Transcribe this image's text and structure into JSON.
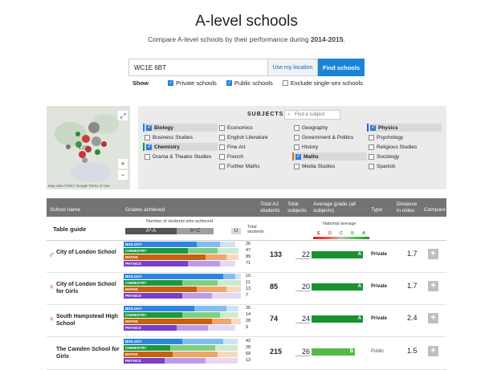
{
  "header": {
    "title": "A-level schools",
    "subtitle_prefix": "Compare A-level schools by their performance during ",
    "subtitle_year": "2014-2015",
    "subtitle_suffix": "."
  },
  "search": {
    "value": "WC1E 6BT",
    "location_label": "Use my location",
    "find_label": "Find schools"
  },
  "show": {
    "label": "Show",
    "options": [
      {
        "label": "Private schools",
        "checked": true
      },
      {
        "label": "Public schools",
        "checked": true
      },
      {
        "label": "Exclude single-sex schools",
        "checked": false
      }
    ]
  },
  "map": {
    "place_label": "Lon",
    "zoom_in": "+",
    "zoom_out": "−",
    "fullscreen": "⤢",
    "credit": "Map data ©2017 Google   Terms of Use"
  },
  "subjects": {
    "heading": "SUBJECTS",
    "search_placeholder": "Find a subject",
    "items": [
      {
        "label": "Biology",
        "checked": true,
        "accent": "#2e86de"
      },
      {
        "label": "Economics",
        "checked": false
      },
      {
        "label": "Geography",
        "checked": false
      },
      {
        "label": "Physics",
        "checked": true,
        "accent": "#7b3fbf"
      },
      {
        "label": "Business Studies",
        "checked": false
      },
      {
        "label": "English Literature",
        "checked": false
      },
      {
        "label": "Government & Politics",
        "checked": false
      },
      {
        "label": "Psychology",
        "checked": false
      },
      {
        "label": "Chemistry",
        "checked": true,
        "accent": "#1a9a3a"
      },
      {
        "label": "Fine Art",
        "checked": false
      },
      {
        "label": "History",
        "checked": false
      },
      {
        "label": "Religious Studies",
        "checked": false
      },
      {
        "label": "Drama & Theatre Studies",
        "checked": false
      },
      {
        "label": "French",
        "checked": false
      },
      {
        "label": "Maths",
        "checked": true,
        "accent": "#e06b10"
      },
      {
        "label": "Sociology",
        "checked": false
      },
      {
        "label": "",
        "checked": false
      },
      {
        "label": "Further Maths",
        "checked": false
      },
      {
        "label": "Media Studies",
        "checked": false
      },
      {
        "label": "Spanish",
        "checked": false
      }
    ]
  },
  "table": {
    "headers": {
      "school": "School name",
      "grades": "Grades achieved",
      "total_a2": "Total A2 students",
      "total_subjects": "Total subjects",
      "avg_grade": "Average grade (all subjects)",
      "type": "Type",
      "distance": "Distance in miles",
      "compare": "Compare"
    },
    "guide": {
      "title": "Table guide",
      "num_students_note": "Number of students who achieved",
      "key_a": "A*-A",
      "key_b": "A*-C",
      "key_u": "U",
      "total_students": "Total students",
      "national_average": "National average",
      "grades": [
        "E",
        "D",
        "C",
        "B",
        "A"
      ]
    },
    "subject_labels": [
      "BIOLOGY",
      "CHEMISTRY",
      "MATHS",
      "PHYSICS"
    ],
    "schools": [
      {
        "name": "City of London School",
        "gender": "boys",
        "counts": [
          "26",
          "47",
          "89",
          "71"
        ],
        "total": "133",
        "subjects": "22",
        "grade": "A",
        "type": "Private",
        "distance": "1.7",
        "fills": [
          [
            0.62,
            0.82,
            0.95
          ],
          [
            0.55,
            0.8,
            0.98
          ],
          [
            0.7,
            0.88,
            0.98
          ],
          [
            0.55,
            0.82,
            0.95
          ]
        ]
      },
      {
        "name": "City of London School for Girls",
        "gender": "girls",
        "counts": [
          "15",
          "11",
          "13",
          "7"
        ],
        "total": "85",
        "subjects": "20",
        "grade": "A",
        "type": "Private",
        "distance": "1.7",
        "fills": [
          [
            0.85,
            0.95,
            1.0
          ],
          [
            0.5,
            0.8,
            1.0
          ],
          [
            0.62,
            0.88,
            1.0
          ],
          [
            0.5,
            0.75,
            1.0
          ]
        ]
      },
      {
        "name": "South Hampstead High School",
        "gender": "girls",
        "counts": [
          "25",
          "14",
          "28",
          "9"
        ],
        "total": "74",
        "subjects": "24",
        "grade": "A",
        "type": "Private",
        "distance": "2.4",
        "fills": [
          [
            0.6,
            0.88,
            0.98
          ],
          [
            0.5,
            0.82,
            0.98
          ],
          [
            0.75,
            0.92,
            1.0
          ],
          [
            0.45,
            0.72,
            0.95
          ]
        ]
      },
      {
        "name": "The Camden School for Girls",
        "gender": "",
        "counts": [
          "42",
          "28",
          "69",
          "13"
        ],
        "total": "215",
        "subjects": "26",
        "grade": "B",
        "type": "Public",
        "distance": "1.5",
        "fills": [
          [
            0.5,
            0.85,
            0.97
          ],
          [
            0.4,
            0.78,
            0.97
          ],
          [
            0.42,
            0.8,
            0.97
          ],
          [
            0.35,
            0.7,
            0.97
          ]
        ]
      }
    ]
  },
  "colors": {
    "bio_dark": "#2e86de",
    "bio_mid": "#82bdf0",
    "bio_light": "#cfe3f6",
    "chem_dark": "#1a9a3a",
    "chem_mid": "#7fcf7f",
    "chem_light": "#cdebcd",
    "maths_dark": "#c8600e",
    "maths_mid": "#f0a56b",
    "maths_light": "#f8d9bf",
    "phys_dark": "#7b3fbf",
    "phys_mid": "#c09ae6",
    "phys_light": "#e6d7f4",
    "grade_green": "#1b9232",
    "grade_light_green": "#58b84a"
  }
}
